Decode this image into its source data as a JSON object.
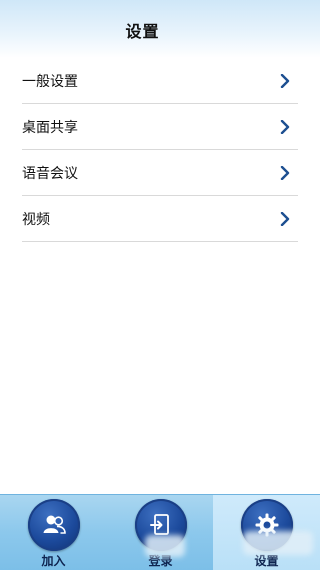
{
  "header": {
    "title": "设置"
  },
  "settings_menu": {
    "items": [
      {
        "label": "一般设置"
      },
      {
        "label": "桌面共享"
      },
      {
        "label": "语音会议"
      },
      {
        "label": "视频"
      }
    ]
  },
  "tabbar": {
    "tabs": [
      {
        "label": "加入",
        "icon": "users-icon"
      },
      {
        "label": "登录",
        "icon": "login-icon"
      },
      {
        "label": "设置",
        "icon": "gear-icon",
        "active": true
      }
    ]
  },
  "colors": {
    "chevron": "#1d4f91",
    "tab_circle": "#1c4a9c",
    "tabbar": "#8cc8ec",
    "divider": "#d9d9d9"
  }
}
